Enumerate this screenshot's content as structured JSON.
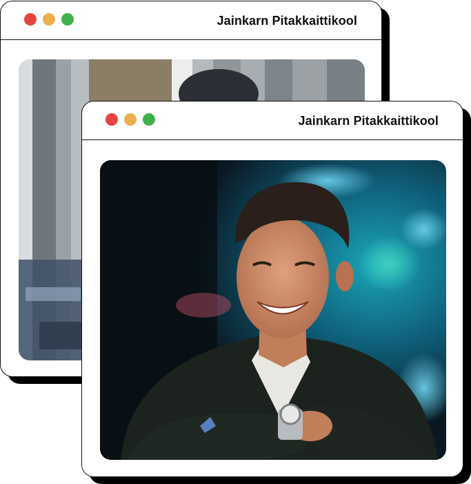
{
  "colors": {
    "close": "#e5453f",
    "minimize": "#ebb04d",
    "maximize": "#40b14d",
    "border": "#111111"
  },
  "windows": [
    {
      "title": "Jainkarn Pitakkaittikool"
    },
    {
      "title": "Jainkarn Pitakkaittikool"
    }
  ]
}
